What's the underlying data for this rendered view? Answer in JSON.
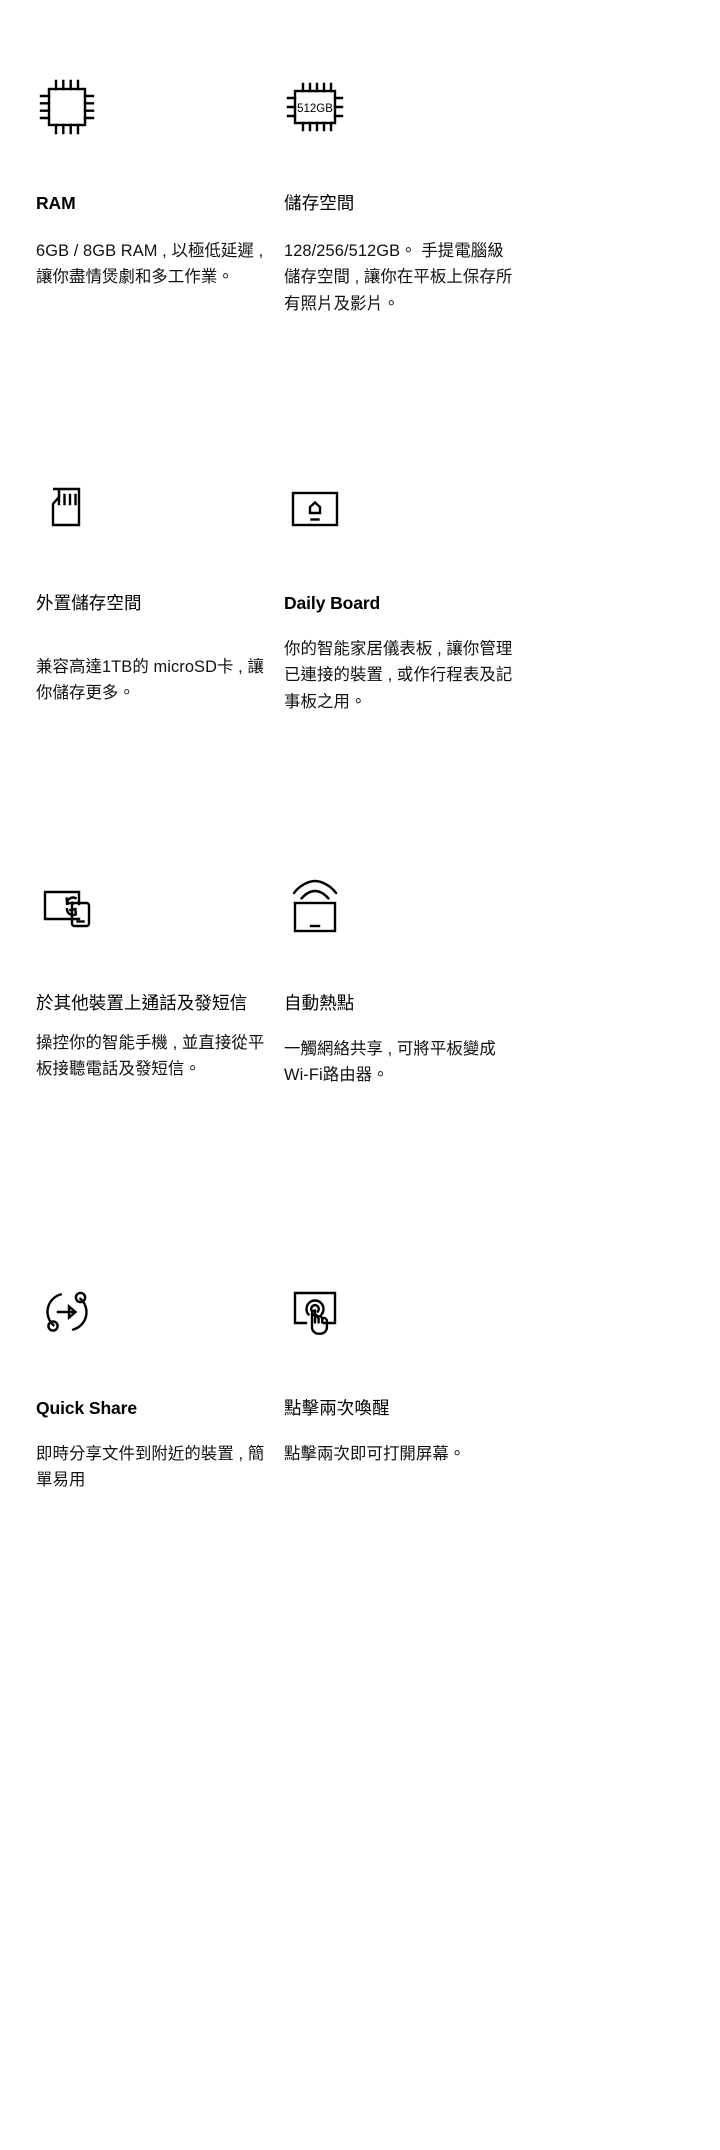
{
  "page": {
    "background_color": "#ffffff",
    "text_color": "#000000",
    "columns": 2,
    "rows": 4
  },
  "features": [
    {
      "icon": "chip-icon",
      "title": "RAM",
      "title_script": "latin",
      "body": "6GB / 8GB RAM , 以極低延遲 , 讓你盡情煲劇和多工作業。"
    },
    {
      "icon": "chip-512gb-icon",
      "icon_label": "512GB",
      "title": "儲存空間",
      "title_script": "cjk",
      "body": "128/256/512GB。 手提電腦級儲存空間 , 讓你在平板上保存所有照片及影片。"
    },
    {
      "icon": "microsd-card-icon",
      "title": "外置儲存空間",
      "title_script": "cjk",
      "body": "兼容高達1TB的 microSD卡 , 讓你儲存更多。"
    },
    {
      "icon": "daily-board-icon",
      "title": "Daily Board",
      "title_script": "latin",
      "body": "你的智能家居儀表板 , 讓你管理已連接的裝置 , 或作行程表及記事板之用。"
    },
    {
      "icon": "call-sms-transfer-icon",
      "title": "於其他裝置上通話及發短信",
      "title_script": "cjk",
      "body": "操控你的智能手機 , 並直接從平板接聽電話及發短信。"
    },
    {
      "icon": "auto-hotspot-icon",
      "title": "自動熱點",
      "title_script": "cjk",
      "body": "一觸網絡共享 , 可將平板變成Wi-Fi路由器。"
    },
    {
      "icon": "quick-share-icon",
      "title": "Quick Share",
      "title_script": "latin",
      "body": "即時分享文件到附近的裝置 , 簡單易用"
    },
    {
      "icon": "double-tap-wake-icon",
      "title": "點擊兩次喚醒",
      "title_script": "cjk",
      "body": "點擊兩次即可打開屏幕。"
    }
  ]
}
